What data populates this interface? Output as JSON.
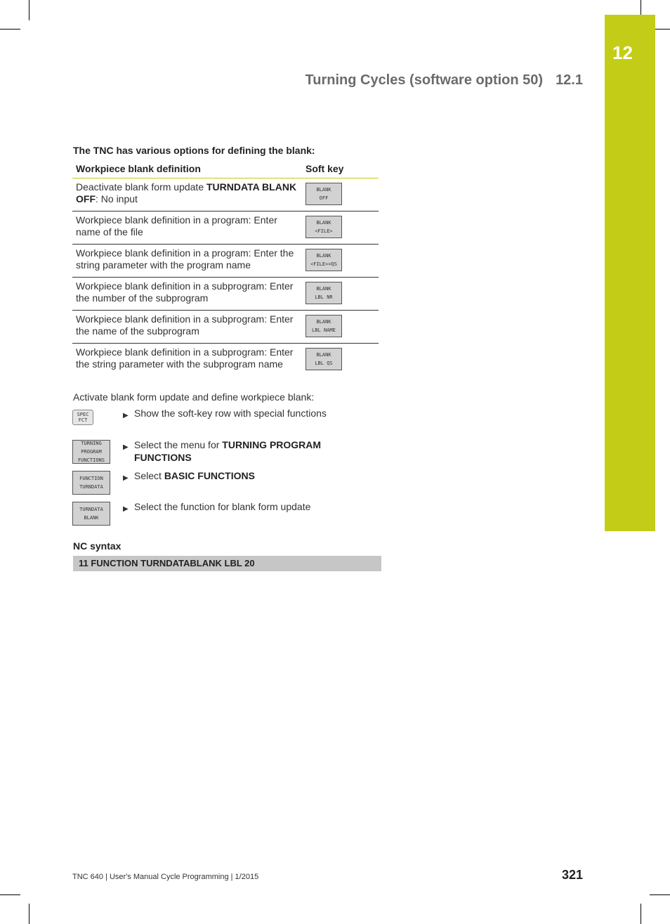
{
  "chapter": {
    "number": "12",
    "color": "#c3cd17"
  },
  "header": {
    "title": "Turning Cycles (software option 50)",
    "section": "12.1"
  },
  "intro": "The TNC has various options for defining the blank:",
  "table": {
    "headers": [
      "Workpiece blank definition",
      "Soft key"
    ],
    "rows": [
      {
        "desc_pre": "Deactivate blank form update ",
        "desc_bold": "TURNDATA BLANK OFF",
        "desc_post": ": No input",
        "key": [
          "BLANK",
          "OFF"
        ]
      },
      {
        "desc_pre": "Workpiece blank definition in a program: Enter name of the file",
        "desc_bold": "",
        "desc_post": "",
        "key": [
          "BLANK",
          "<FILE>"
        ]
      },
      {
        "desc_pre": "Workpiece blank definition in a program: Enter the string parameter with the program name",
        "desc_bold": "",
        "desc_post": "",
        "key": [
          "BLANK",
          "<FILE>=QS"
        ]
      },
      {
        "desc_pre": "Workpiece blank definition in a subprogram: Enter the number of the subprogram",
        "desc_bold": "",
        "desc_post": "",
        "key": [
          "BLANK",
          "LBL NR"
        ]
      },
      {
        "desc_pre": "Workpiece blank definition in a subprogram: Enter the name of the subprogram",
        "desc_bold": "",
        "desc_post": "",
        "key": [
          "BLANK",
          "LBL NAME"
        ]
      },
      {
        "desc_pre": "Workpiece blank definition in a subprogram: Enter the string parameter with the subprogram name",
        "desc_bold": "",
        "desc_post": "",
        "key": [
          "BLANK",
          "LBL QS"
        ]
      }
    ]
  },
  "activate": "Activate blank form update and define workpiece blank:",
  "steps": [
    {
      "key": [
        "SPEC",
        "FCT"
      ],
      "text_pre": "Show the soft-key row with special functions",
      "text_bold": ""
    },
    {
      "key": [
        "TURNING",
        "PROGRAM",
        "FUNCTIONS"
      ],
      "text_pre": "Select the menu for ",
      "text_bold": "TURNING PROGRAM FUNCTIONS"
    },
    {
      "key": [
        "FUNCTION",
        "TURNDATA"
      ],
      "text_pre": "Select ",
      "text_bold": "BASIC FUNCTIONS"
    },
    {
      "key": [
        "TURNDATA",
        "BLANK"
      ],
      "text_pre": "Select the function for blank form update",
      "text_bold": ""
    }
  ],
  "nc": {
    "label": "NC syntax",
    "code": "11 FUNCTION TURNDATABLANK LBL 20"
  },
  "footer": {
    "text": "TNC 640 | User's Manual Cycle Programming | 1/2015",
    "page": "321"
  }
}
